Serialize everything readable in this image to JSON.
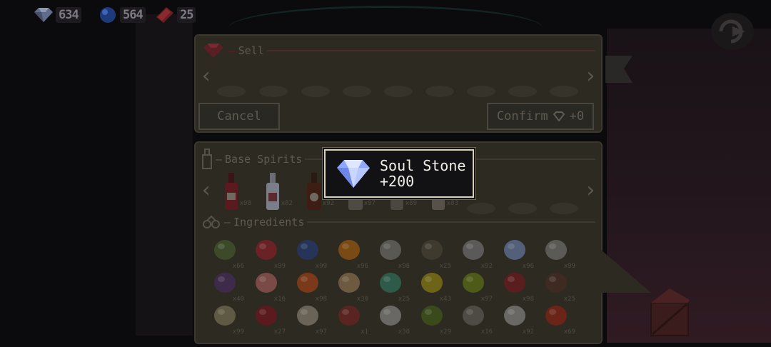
{
  "currency": {
    "gems": "634",
    "orbs": "564",
    "tickets": "25"
  },
  "sell": {
    "title": "Sell",
    "cancel_label": "Cancel",
    "confirm_label": "Confirm",
    "confirm_amount": "+0"
  },
  "base_spirits": {
    "title": "Base Spirits",
    "items": [
      {
        "name": "red-wine-bottle",
        "count": "x98"
      },
      {
        "name": "vodka-bottle",
        "count": "x82"
      },
      {
        "name": "whiskey-bottle",
        "count": "x92"
      },
      {
        "name": "liquor-bottle-4",
        "count": "x97"
      },
      {
        "name": "liquor-bottle-5",
        "count": "x89"
      },
      {
        "name": "liquor-bottle-6",
        "count": "x83"
      }
    ]
  },
  "ingredients": {
    "title": "Ingredients",
    "rows": [
      [
        {
          "name": "mint",
          "count": "x66"
        },
        {
          "name": "strawberry",
          "count": "x99"
        },
        {
          "name": "blueberry",
          "count": "x99"
        },
        {
          "name": "orange",
          "count": "x96"
        },
        {
          "name": "cream-pitcher",
          "count": "x98"
        },
        {
          "name": "bowl",
          "count": "x25"
        },
        {
          "name": "ice-shard",
          "count": "x92"
        },
        {
          "name": "ice-cube",
          "count": "x96"
        },
        {
          "name": "sugar-bowl",
          "count": "x99"
        }
      ],
      [
        {
          "name": "grapes",
          "count": "x40"
        },
        {
          "name": "peach",
          "count": "x16"
        },
        {
          "name": "honey-jar",
          "count": "x98"
        },
        {
          "name": "custard",
          "count": "x30"
        },
        {
          "name": "melon-slice",
          "count": "x25"
        },
        {
          "name": "lemon",
          "count": "x43"
        },
        {
          "name": "lime",
          "count": "x97"
        },
        {
          "name": "tomato-sauce",
          "count": "x98"
        },
        {
          "name": "cocoa",
          "count": "x25"
        }
      ],
      [
        {
          "name": "vanilla",
          "count": "x99"
        },
        {
          "name": "pomegranate",
          "count": "x27"
        },
        {
          "name": "popcorn",
          "count": "x97"
        },
        {
          "name": "chili-jar",
          "count": "x1"
        },
        {
          "name": "salt-pile",
          "count": "x30"
        },
        {
          "name": "avocado",
          "count": "x29"
        },
        {
          "name": "hot-sauce",
          "count": "x16"
        },
        {
          "name": "sugar-pile",
          "count": "x92"
        },
        {
          "name": "apple",
          "count": "x69"
        }
      ]
    ]
  },
  "toast": {
    "title": "Soul Stone",
    "amount": "+200"
  },
  "colors": {
    "panel": "#2d2a22",
    "toast_border": "#d9d2b8",
    "accent_red": "#7a1f24",
    "gem_blue": "#9fb6ff"
  }
}
